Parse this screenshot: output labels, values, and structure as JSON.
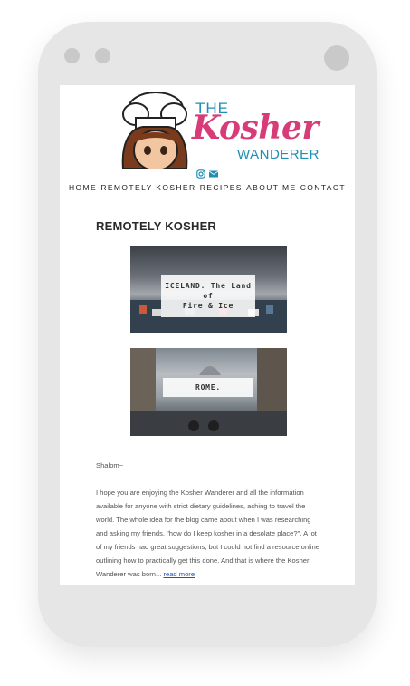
{
  "logo": {
    "line1": "THE",
    "line2": "Kosher",
    "line3": "WANDERER"
  },
  "social": {
    "icons": [
      "instagram-icon",
      "envelope-icon"
    ],
    "color": "#1d8fb3"
  },
  "nav": {
    "items": [
      "HOME",
      "REMOTELY KOSHER",
      "RECIPES",
      "ABOUT ME",
      "CONTACT"
    ]
  },
  "page": {
    "heading": "REMOTELY KOSHER"
  },
  "cards": [
    {
      "title_line1": "ICELAND. The Land of",
      "title_line2": "Fire & Ice"
    },
    {
      "title": "ROME."
    }
  ],
  "intro": {
    "greeting": "Shalom~",
    "body": "I hope you are enjoying the Kosher Wanderer and all the information available for anyone with strict dietary guidelines, aching to travel the world. The whole idea for the blog came about when I was researching and asking my friends, \"how do I keep kosher in a desolate place?\". A lot of my friends had great suggestions, but I could not find a resource online outlining how to practically get this done. And that is where the Kosher Wanderer was born...",
    "link": "read more"
  },
  "colors": {
    "brand_teal": "#1d8fb3",
    "brand_pink": "#d73c78",
    "phone_frame": "#e6e6e6"
  }
}
